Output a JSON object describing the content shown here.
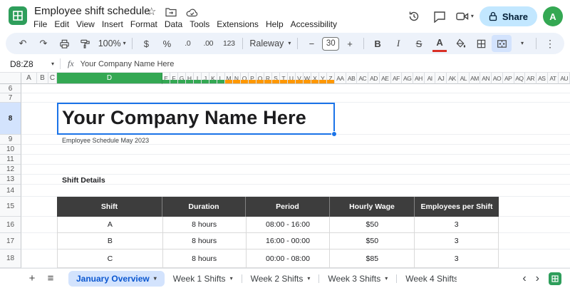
{
  "colors": {
    "sheets_green": "#34a853",
    "band_green": "#34a853",
    "band_orange": "#ff9800",
    "accent_blue": "#0b57d0",
    "selection_blue": "#1a73e8",
    "share_bg": "#c2e7ff",
    "toolbar_bg": "#edf2fa",
    "active_tab_bg": "#d3e3fd",
    "table_header_bg": "#3d3d3d",
    "text_color_sample": "#d93025"
  },
  "icons": {
    "star": "☆",
    "undo": "↶",
    "redo": "↷",
    "caret": "▾",
    "more_vertical": "⋮",
    "hamburger": "≡",
    "add": "+",
    "minus": "−",
    "plus": "+",
    "scroll_left": "‹",
    "scroll_right": "›"
  },
  "topbar": {
    "doc_title": "Employee shift schedule",
    "menus": [
      "File",
      "Edit",
      "View",
      "Insert",
      "Format",
      "Data",
      "Tools",
      "Extensions",
      "Help",
      "Accessibility"
    ],
    "share_label": "Share",
    "avatar_letter": "A"
  },
  "toolbar": {
    "zoom": "100%",
    "currency": "$",
    "percent": "%",
    "decimal_decrease": ".0",
    "decimal_increase": ".00",
    "format_number": "123",
    "font_name": "Raleway",
    "font_size": "30",
    "bold": "B",
    "italic": "I",
    "strikethrough": "S",
    "text_color": "A"
  },
  "formula_bar": {
    "cell_ref": "D8:Z8",
    "fx_label": "fx",
    "value": "Your Company Name Here"
  },
  "grid": {
    "cols_abc": [
      "A",
      "B",
      "C"
    ],
    "col_d": "D",
    "cols_green": [
      "E",
      "F",
      "G",
      "H",
      "I",
      "J",
      "K",
      "L"
    ],
    "cols_orange": [
      "M",
      "N",
      "O",
      "P",
      "Q",
      "R",
      "S",
      "T",
      "U",
      "V",
      "W",
      "X",
      "Y",
      "Z"
    ],
    "cols_wide": [
      "AA",
      "AB",
      "AC",
      "AD",
      "AE",
      "AF",
      "AG",
      "AH",
      "AI",
      "AJ",
      "AK",
      "AL",
      "AM",
      "AN",
      "AO",
      "AP",
      "AQ",
      "AR",
      "AS",
      "AT",
      "AU"
    ],
    "rows": [
      "6",
      "7",
      "8",
      "9",
      "10",
      "11",
      "12",
      "13",
      "14",
      "15",
      "16",
      "17",
      "18"
    ]
  },
  "sheet": {
    "company_title": "Your Company Name Here",
    "subtitle": "Employee Schedule May 2023",
    "section_heading": "Shift Details",
    "table": {
      "headers": [
        "Shift",
        "Duration",
        "Period",
        "Hourly Wage",
        "Employees per Shift"
      ],
      "rows": [
        [
          "A",
          "8 hours",
          "08:00 - 16:00",
          "$50",
          "3"
        ],
        [
          "B",
          "8 hours",
          "16:00 - 00:00",
          "$50",
          "3"
        ],
        [
          "C",
          "8 hours",
          "00:00 - 08:00",
          "$85",
          "3"
        ]
      ]
    }
  },
  "footer": {
    "active_tab": "January Overview",
    "tabs": [
      "Week 1 Shifts",
      "Week 2 Shifts",
      "Week 3 Shifts",
      "Week 4 Shifts"
    ]
  }
}
